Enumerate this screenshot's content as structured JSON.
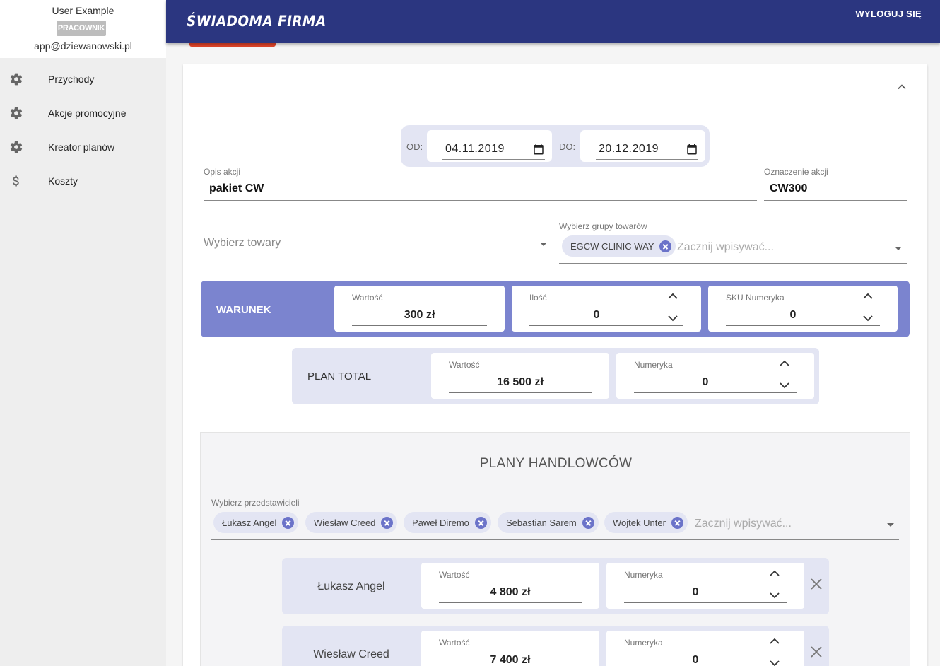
{
  "user": {
    "name": "User Example",
    "role": "PRACOWNIK",
    "email": "app@dziewanowski.pl"
  },
  "sidebar": {
    "items": [
      {
        "label": "Przychody",
        "icon": "gear-icon"
      },
      {
        "label": "Akcje promocyjne",
        "icon": "gear-icon"
      },
      {
        "label": "Kreator planów",
        "icon": "gear-icon"
      },
      {
        "label": "Koszty",
        "icon": "dollar-icon"
      }
    ]
  },
  "header": {
    "brand": "ŚWIADOMA FIRMA",
    "logout": "WYLOGUJ SIĘ"
  },
  "dates": {
    "from_label": "OD:",
    "from_value": "04.11.2019",
    "to_label": "DO:",
    "to_value": "20.12.2019"
  },
  "opis": {
    "label": "Opis akcji",
    "value": "pakiet CW"
  },
  "oznaczenie": {
    "label": "Oznaczenie akcji",
    "value": "CW300"
  },
  "towary": {
    "placeholder": "Wybierz towary"
  },
  "grupy": {
    "label": "Wybierz grupy towarów",
    "chip": "EGCW CLINIC WAY",
    "placeholder": "Zacznij wpisywać..."
  },
  "warunek": {
    "label": "WARUNEK",
    "wartosc_label": "Wartość",
    "wartosc_value": "300  zł",
    "ilosc_label": "Ilość",
    "ilosc_value": "0",
    "sku_label": "SKU Numeryka",
    "sku_value": "0"
  },
  "plan_total": {
    "label": "PLAN TOTAL",
    "wartosc_label": "Wartość",
    "wartosc_value": "16 500  zł",
    "numeryka_label": "Numeryka",
    "numeryka_value": "0"
  },
  "plany": {
    "title": "PLANY HANDLOWCÓW",
    "select_label": "Wybierz przedstawicieli",
    "chips": [
      "Łukasz Angel",
      "Wiesław Creed",
      "Paweł Diremo",
      "Sebastian Sarem",
      "Wojtek Unter"
    ],
    "placeholder": "Zacznij wpisywać...",
    "rows": [
      {
        "name": "Łukasz Angel",
        "wartosc_label": "Wartość",
        "wartosc_value": "4 800  zł",
        "numeryka_label": "Numeryka",
        "numeryka_value": "0"
      },
      {
        "name": "Wiesław Creed",
        "wartosc_label": "Wartość",
        "wartosc_value": "7 400  zł",
        "numeryka_label": "Numeryka",
        "numeryka_value": "0"
      }
    ]
  },
  "colors": {
    "topbar": "#2b3680",
    "accent": "#7b84cf",
    "panel": "#e3e5f3",
    "chip_x": "#6b73c9",
    "red_tab": "#e0442a"
  }
}
